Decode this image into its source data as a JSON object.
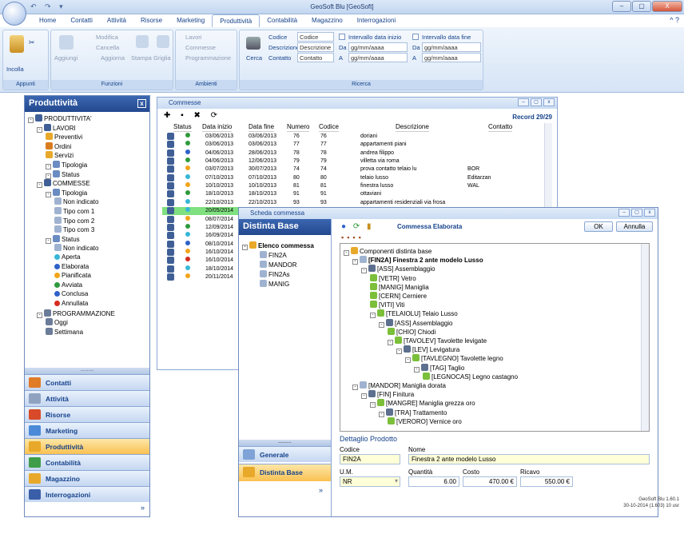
{
  "app": {
    "title": "GeoSoft Blu [GeoSoft]",
    "window_buttons": [
      "–",
      "▢",
      "X"
    ],
    "qat": "↶ ↷ ▾",
    "help_glyph": "^ ?"
  },
  "menu": {
    "tabs": [
      "Home",
      "Contatti",
      "Attività",
      "Risorse",
      "Marketing",
      "Produttività",
      "Contabilità",
      "Magazzino",
      "Interrogazioni"
    ],
    "active": "Produttività"
  },
  "ribbon": {
    "appunti": {
      "label": "Appunti",
      "incolla": "Incolla"
    },
    "funzioni": {
      "label": "Funzioni",
      "aggiungi": "Aggiungi",
      "modifica": "Modifica",
      "cancella": "Cancella",
      "aggiorna": "Aggiorna",
      "stampa": "Stampa",
      "griglia": "Griglia"
    },
    "ambienti": {
      "label": "Ambienti",
      "lavori": "Lavori",
      "commesse": "Commesse",
      "programmazione": "Programmazione"
    },
    "ricerca": {
      "label": "Ricerca",
      "cerca": "Cerca",
      "codice_lbl": "Codice",
      "codice_val": "Codice",
      "descrizione_lbl": "Descrizione",
      "descrizione_val": "Descrizione",
      "contatto_lbl": "Contatto",
      "contatto_val": "Contatto",
      "int_inizio": "Intervallo data inizio",
      "int_fine": "Intervallo data fine",
      "da": "Da",
      "a": "A",
      "date_ph": "gg/mm/aaaa"
    }
  },
  "sidebar": {
    "title": "Produttività",
    "close": "x",
    "grip": "..........",
    "tree": [
      "PRODUTTIVITA'",
      "LAVORI",
      "Preventivi",
      "Ordini",
      "Servizi",
      "Tipologia",
      "Status",
      "COMMESSE",
      "Tipologia",
      "Non indicato",
      "Tipo com 1",
      "Tipo com 2",
      "Tipo com 3",
      "Status",
      "Non indicato",
      "Aperta",
      "Elaborata",
      "Pianificata",
      "Avviata",
      "Conclusa",
      "Annullata",
      "PROGRAMMAZIONE",
      "Oggi",
      "Settimana"
    ],
    "nav": [
      "Contatti",
      "Attività",
      "Risorse",
      "Marketing",
      "Produttività",
      "Contabilità",
      "Magazzino",
      "Interrogazioni"
    ],
    "nav_active": "Produttività",
    "more": "»"
  },
  "commesse": {
    "title": "Commesse",
    "record": "Record 29/29",
    "toolbar": "✚ ▪ ✖ ⟳",
    "columns": [
      "Status",
      "Data inizio",
      "Data fine",
      "Numero",
      "Codice",
      "Descrizione",
      "Contatto"
    ],
    "rows": [
      {
        "di": "03/06/2013",
        "df": "03/06/2013",
        "num": "76",
        "cod": "76",
        "desc": "doriani",
        "cont": "",
        "color": "#2e9a3c"
      },
      {
        "di": "03/06/2013",
        "df": "03/06/2013",
        "num": "77",
        "cod": "77",
        "desc": "appartamenti piani",
        "cont": "",
        "color": "#2e9a3c"
      },
      {
        "di": "04/06/2013",
        "df": "28/06/2013",
        "num": "78",
        "cod": "78",
        "desc": "andrea filippo",
        "cont": "",
        "color": "#2e61c9"
      },
      {
        "di": "04/06/2013",
        "df": "12/06/2013",
        "num": "79",
        "cod": "79",
        "desc": "villetta via roma",
        "cont": "",
        "color": "#2e9a3c"
      },
      {
        "di": "03/07/2013",
        "df": "30/07/2013",
        "num": "74",
        "cod": "74",
        "desc": "prova contatto telaio lu",
        "cont": "BOR",
        "color": "#f2a51a"
      },
      {
        "di": "07/10/2013",
        "df": "07/10/2013",
        "num": "80",
        "cod": "80",
        "desc": "telaio lusso",
        "cont": "Editarzan",
        "color": "#35b7d6"
      },
      {
        "di": "10/10/2013",
        "df": "10/10/2013",
        "num": "81",
        "cod": "81",
        "desc": "finestra lusso",
        "cont": "WAL",
        "color": "#f2a51a"
      },
      {
        "di": "18/10/2013",
        "df": "18/10/2013",
        "num": "91",
        "cod": "91",
        "desc": "ottaviani",
        "cont": "",
        "color": "#2e9a3c"
      },
      {
        "di": "22/10/2013",
        "df": "22/10/2013",
        "num": "93",
        "cod": "93",
        "desc": "appartamenti residenziali via frosa",
        "cont": "",
        "color": "#35b7d6"
      },
      {
        "di": "20/05/2014",
        "df": "",
        "num": "",
        "cod": "",
        "desc": "",
        "cont": "",
        "color": "#35b7d6",
        "sel": true
      },
      {
        "di": "08/07/2014",
        "df": "",
        "num": "",
        "cod": "",
        "desc": "",
        "cont": "",
        "color": "#f2a51a"
      },
      {
        "di": "12/09/2014",
        "df": "",
        "num": "",
        "cod": "",
        "desc": "",
        "cont": "",
        "color": "#2e9a3c"
      },
      {
        "di": "16/09/2014",
        "df": "",
        "num": "",
        "cod": "",
        "desc": "",
        "cont": "",
        "color": "#35b7d6"
      },
      {
        "di": "08/10/2014",
        "df": "",
        "num": "",
        "cod": "",
        "desc": "",
        "cont": "",
        "color": "#2e61c9"
      },
      {
        "di": "16/10/2014",
        "df": "",
        "num": "",
        "cod": "",
        "desc": "",
        "cont": "",
        "color": "#f2a51a"
      },
      {
        "di": "16/10/2014",
        "df": "",
        "num": "",
        "cod": "",
        "desc": "",
        "cont": "",
        "color": "#d52b1e"
      },
      {
        "di": "18/10/2014",
        "df": "",
        "num": "",
        "cod": "",
        "desc": "",
        "cont": "",
        "color": "#35b7d6"
      },
      {
        "di": "20/11/2014",
        "df": "",
        "num": "",
        "cod": "",
        "desc": "",
        "cont": "",
        "color": "#f2a51a"
      }
    ]
  },
  "scheda": {
    "title": "Scheda commessa",
    "list_title": "Distinta Base",
    "list_root": "Elenco commessa",
    "list_items": [
      "FIN2A",
      "MANDOR",
      "FIN2As",
      "MANIG"
    ],
    "grip": "..........",
    "tabs": [
      "Generale",
      "Distinta Base"
    ],
    "tab_active": "Distinta Base",
    "more": "»",
    "header_title": "Commessa Elaborata",
    "ok": "OK",
    "annulla": "Annulla",
    "tree": [
      {
        "t": "Componenti distinta base",
        "l": 0,
        "b": false
      },
      {
        "t": "[FIN2A] Finestra 2 ante modelo Lusso",
        "l": 1,
        "b": true
      },
      {
        "t": "[ASS] Assemblaggio",
        "l": 2,
        "b": false
      },
      {
        "t": "[VETR] Vetro",
        "l": 3,
        "b": false
      },
      {
        "t": "[MANIG] Maniglia",
        "l": 3,
        "b": false
      },
      {
        "t": "[CERN] Cerniere",
        "l": 3,
        "b": false
      },
      {
        "t": "[VITI] Viti",
        "l": 3,
        "b": false
      },
      {
        "t": "[TELAIOLU] Telaio Lusso",
        "l": 3,
        "b": false
      },
      {
        "t": "[ASS] Assemblaggio",
        "l": 4,
        "b": false
      },
      {
        "t": "[CHIO] Chiodi",
        "l": 5,
        "b": false
      },
      {
        "t": "[TAVOLEV] Tavolette levigate",
        "l": 5,
        "b": false
      },
      {
        "t": "[LEV] Levigatura",
        "l": 6,
        "b": false
      },
      {
        "t": "[TAVLEGNO] Tavolette legno",
        "l": 7,
        "b": false
      },
      {
        "t": "[TAG] Taglio",
        "l": 8,
        "b": false
      },
      {
        "t": "[LEGNOCAS] Legno castagno",
        "l": 9,
        "b": false
      },
      {
        "t": "[MANDOR] Maniglia dorata",
        "l": 1,
        "b": false
      },
      {
        "t": "[FIN] Finitura",
        "l": 2,
        "b": false
      },
      {
        "t": "[MANGRE] Maniglia grezza oro",
        "l": 3,
        "b": false
      },
      {
        "t": "[TRA] Trattamento",
        "l": 4,
        "b": false
      },
      {
        "t": "[VERORO] Vernice oro",
        "l": 5,
        "b": false
      }
    ],
    "dettaglio": {
      "title": "Dettaglio Prodotto",
      "codice_lbl": "Codice",
      "codice": "FIN2A",
      "nome_lbl": "Nome",
      "nome": "Finestra 2 ante modelo Lusso",
      "um_lbl": "U.M.",
      "um": "NR",
      "qta_lbl": "Quantità",
      "qta": "6.00",
      "costo_lbl": "Costo",
      "costo": "470.00 €",
      "ricavo_lbl": "Ricavo",
      "ricavo": "550.00 €"
    }
  },
  "status": {
    "version": "GeoSoft Blu 1.60.1",
    "build": "30-10-2014 (1.603) 10 usr"
  }
}
